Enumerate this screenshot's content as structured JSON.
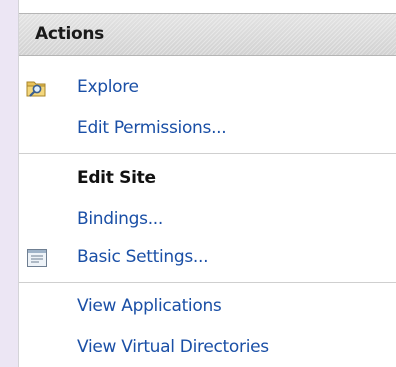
{
  "panel": {
    "title": "Actions",
    "items": [
      {
        "label": "Explore",
        "icon": "folder-explore-icon"
      },
      {
        "label": "Edit Permissions..."
      }
    ],
    "edit_site": {
      "heading": "Edit Site",
      "items": [
        {
          "label": "Bindings..."
        },
        {
          "label": "Basic Settings...",
          "icon": "settings-window-icon"
        }
      ]
    },
    "applications": {
      "items": [
        {
          "label": "View Applications"
        },
        {
          "label": "View Virtual Directories"
        }
      ]
    }
  },
  "colors": {
    "link": "#1a4fa6",
    "background": "#ece6f4",
    "header": "#d8d8d8"
  }
}
